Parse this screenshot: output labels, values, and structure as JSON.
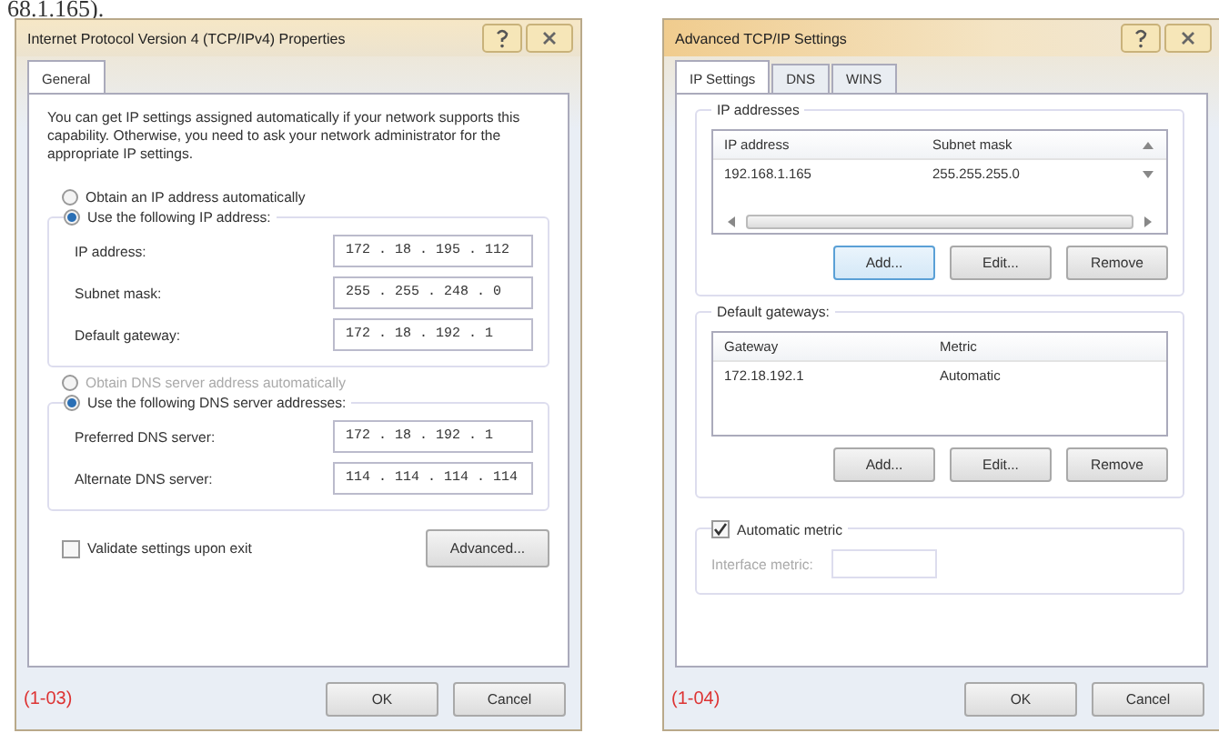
{
  "caption_fragment": "68.1.165).",
  "ipv4_dialog": {
    "title": "Internet Protocol Version 4 (TCP/IPv4) Properties",
    "tabs": [
      {
        "label": "General",
        "selected": true
      }
    ],
    "intro": "You can get IP settings assigned automatically if your network supports this capability. Otherwise, you need to ask your network administrator for the appropriate IP settings.",
    "ip_mode": [
      {
        "label": "Obtain an IP address automatically",
        "selected": false,
        "disabled": false
      },
      {
        "label": "Use the following IP address:",
        "selected": true,
        "disabled": false
      }
    ],
    "ip_fields": [
      {
        "label": "IP address:",
        "value": "172 . 18 . 195 . 112"
      },
      {
        "label": "Subnet mask:",
        "value": "255 . 255 . 248 . 0"
      },
      {
        "label": "Default gateway:",
        "value": "172 . 18 . 192 . 1"
      }
    ],
    "dns_mode": [
      {
        "label": "Obtain DNS server address automatically",
        "selected": false,
        "disabled": true
      },
      {
        "label": "Use the following DNS server addresses:",
        "selected": true,
        "disabled": false
      }
    ],
    "dns_fields": [
      {
        "label": "Preferred DNS server:",
        "value": "172 . 18 . 192 . 1"
      },
      {
        "label": "Alternate DNS server:",
        "value": "114 . 114 . 114 . 114"
      }
    ],
    "validate": {
      "label": "Validate settings upon exit",
      "checked": false
    },
    "advanced_button": "Advanced...",
    "figure_label": "(1-03)",
    "buttons": [
      "OK",
      "Cancel"
    ]
  },
  "advanced_dialog": {
    "title": "Advanced TCP/IP Settings",
    "tabs": [
      {
        "label": "IP Settings",
        "selected": true
      },
      {
        "label": "DNS",
        "selected": false
      },
      {
        "label": "WINS",
        "selected": false
      }
    ],
    "ip_addresses": {
      "title": "IP addresses",
      "columns": [
        "IP address",
        "Subnet mask"
      ],
      "rows": [
        [
          "192.168.1.165",
          "255.255.255.0"
        ]
      ],
      "buttons": [
        "Add...",
        "Edit...",
        "Remove"
      ]
    },
    "gateways": {
      "title": "Default gateways:",
      "columns": [
        "Gateway",
        "Metric"
      ],
      "rows": [
        [
          "172.18.192.1",
          "Automatic"
        ]
      ],
      "buttons": [
        "Add...",
        "Edit...",
        "Remove"
      ]
    },
    "automatic_metric": {
      "label": "Automatic metric",
      "checked": true
    },
    "interface_metric": {
      "label": "Interface metric:",
      "disabled": true
    },
    "figure_label": "(1-04)",
    "buttons": [
      "OK",
      "Cancel"
    ]
  }
}
